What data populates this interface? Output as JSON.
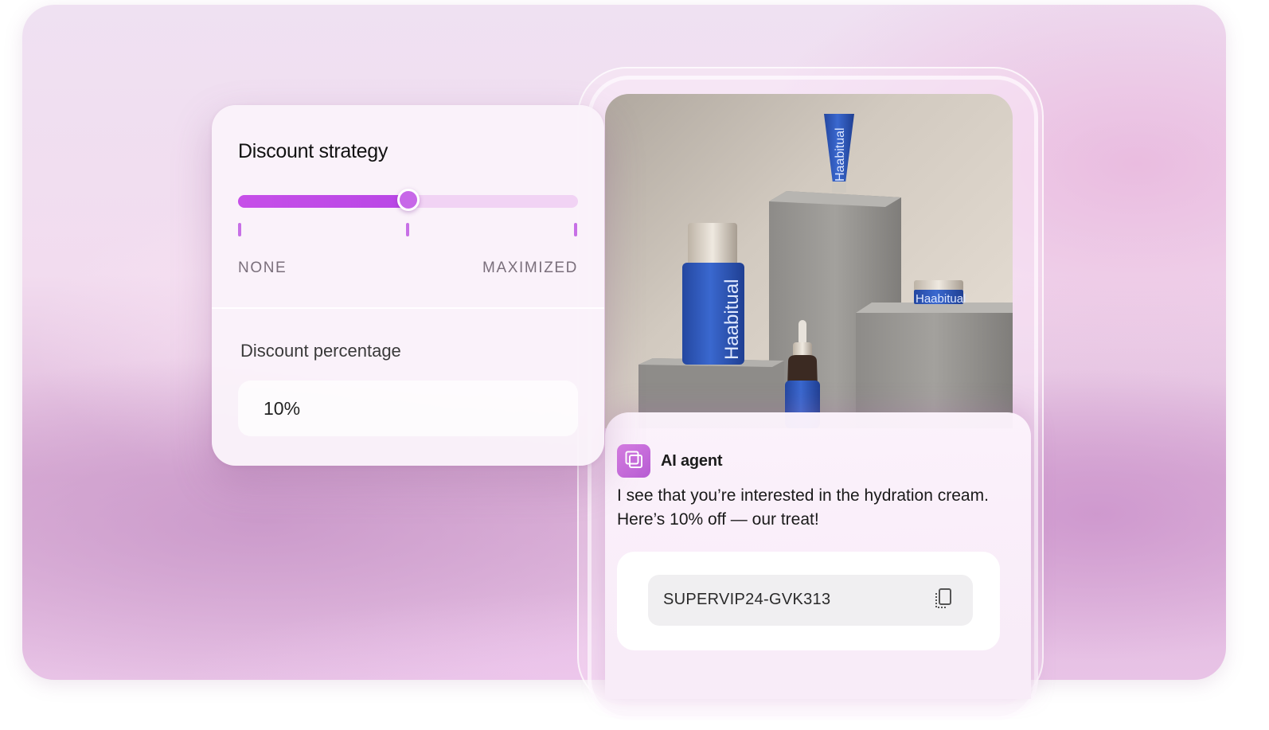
{
  "discount_panel": {
    "title": "Discount strategy",
    "slider": {
      "level_percent": 50,
      "min_label": "NONE",
      "max_label": "MAXIMIZED"
    },
    "percentage_label": "Discount percentage",
    "percentage_value": "10%"
  },
  "product_photo": {
    "brand": "Haabitual"
  },
  "chat": {
    "agent_name": "AI agent",
    "message": "I see that you’re interested in the hydration cream. Here’s 10% off  — our treat!",
    "coupon_code": "SUPERVIP24-GVK313"
  },
  "colors": {
    "accent": "#c64fe8",
    "track": "#f1d3f4",
    "product_blue": "#2f58b5"
  },
  "icons": [
    "agent-logo-icon",
    "copy-icon"
  ]
}
